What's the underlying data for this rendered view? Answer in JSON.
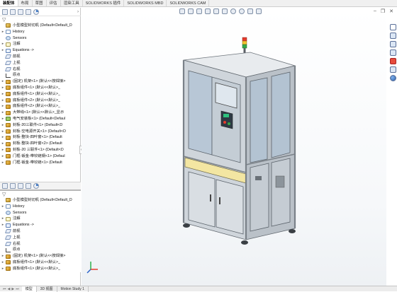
{
  "command_tabs": [
    {
      "label": "装配体",
      "active": true
    },
    {
      "label": "布局"
    },
    {
      "label": "草图"
    },
    {
      "label": "评估"
    },
    {
      "label": "渲染工具"
    },
    {
      "label": "SOLIDWORKS 插件"
    },
    {
      "label": "SOLIDWORKS MBD"
    },
    {
      "label": "SOLIDWORKS CAM"
    }
  ],
  "tree_top": [
    {
      "label": "小型模型封切机 (Default<Default_D",
      "icon": "asm",
      "expand": "",
      "top": true
    },
    {
      "label": "History",
      "icon": "hist",
      "expand": "▸"
    },
    {
      "label": "Sensors",
      "icon": "sens",
      "expand": ""
    },
    {
      "label": "注解",
      "icon": "note",
      "expand": "▸"
    },
    {
      "label": "Equations ->",
      "icon": "eq",
      "expand": "▸"
    },
    {
      "label": "前视",
      "icon": "plane",
      "expand": ""
    },
    {
      "label": "上视",
      "icon": "plane",
      "expand": ""
    },
    {
      "label": "右视",
      "icon": "plane",
      "expand": ""
    },
    {
      "label": "原点",
      "icon": "origin",
      "expand": ""
    },
    {
      "label": "(固定) 机架<1> (默认<<按焊接>",
      "icon": "part",
      "expand": "▸"
    },
    {
      "label": "底板组件<1> (默认<<默认>_",
      "icon": "part",
      "expand": "▸"
    },
    {
      "label": "底板组件<1> (默认<<默认>_",
      "icon": "part",
      "expand": "▸"
    },
    {
      "label": "底板组件<2> (默认<<默认>_",
      "icon": "part",
      "expand": "▸"
    },
    {
      "label": "底板组件<2> (默认<<默认>_",
      "icon": "part",
      "expand": "▸"
    },
    {
      "label": "大带线<1> (默认<<默认>_显示",
      "icon": "part",
      "expand": "▸"
    },
    {
      "label": "电气安装板<1> (Default<Defaul",
      "icon": "elec",
      "expand": "▸"
    },
    {
      "label": "封板-20三联件<1> (Default<D",
      "icon": "part",
      "expand": "▸"
    },
    {
      "label": "封板-空电源开关<1> (Default<D",
      "icon": "part",
      "expand": "▸"
    },
    {
      "label": "封板-整块-四叶窗<1> (Default",
      "icon": "part",
      "expand": "▸"
    },
    {
      "label": "封板-整块-四叶窗<2> (Default",
      "icon": "part",
      "expand": "▸"
    },
    {
      "label": "封板-20 三联件<1> (Default<D",
      "icon": "part",
      "expand": "▸"
    },
    {
      "label": "门框-钣金-带铰链钢<1> (Defaul",
      "icon": "part",
      "expand": "▸"
    },
    {
      "label": "门框-钣金-带铰链<1> (Default",
      "icon": "part",
      "expand": "▸"
    }
  ],
  "tree_bottom": [
    {
      "label": "小型模型封切机 (Default<Default_D",
      "icon": "asm",
      "expand": "",
      "top": true
    },
    {
      "label": "History",
      "icon": "hist",
      "expand": "▸"
    },
    {
      "label": "Sensors",
      "icon": "sens",
      "expand": ""
    },
    {
      "label": "注解",
      "icon": "note",
      "expand": "▸"
    },
    {
      "label": "Equations ->",
      "icon": "eq",
      "expand": "▸"
    },
    {
      "label": "前视",
      "icon": "plane",
      "expand": ""
    },
    {
      "label": "上视",
      "icon": "plane",
      "expand": ""
    },
    {
      "label": "右视",
      "icon": "plane",
      "expand": ""
    },
    {
      "label": "原点",
      "icon": "origin",
      "expand": ""
    },
    {
      "label": "(固定) 机架<1> (默认<<按焊接>",
      "icon": "part",
      "expand": "▸"
    },
    {
      "label": "底板组件<1> (默认<<默认>_",
      "icon": "part",
      "expand": "▸"
    },
    {
      "label": "底板组件<1> (默认<<默认>_",
      "icon": "part",
      "expand": "▸"
    }
  ],
  "bottom_tabs": [
    {
      "label": "模型",
      "active": true
    },
    {
      "label": "3D 视图"
    },
    {
      "label": "Motion Study 1"
    }
  ],
  "colors": {
    "frame": "#8e959c",
    "panel_blue": "#b9c9d8",
    "accent_yellow": "#f3e6a2",
    "tower_red": "#e53b2c",
    "tower_yellow": "#f2c230",
    "tower_green": "#35a84a"
  }
}
